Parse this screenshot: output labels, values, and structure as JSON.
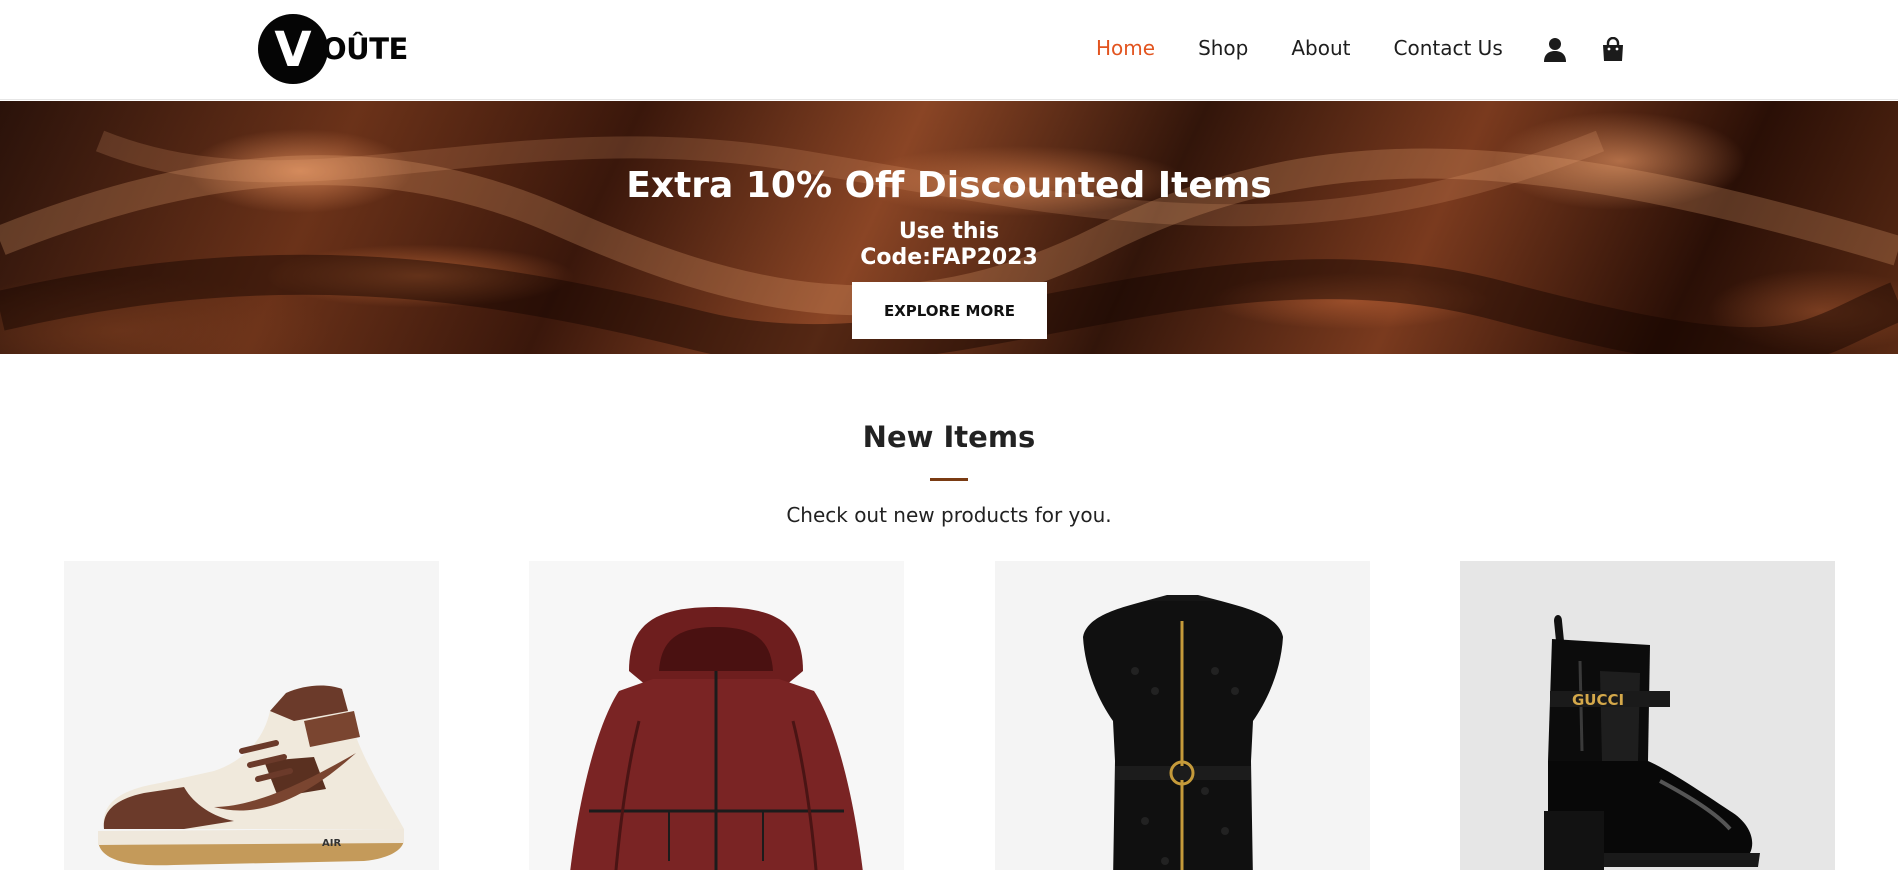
{
  "brand": {
    "logo_letter": "V",
    "logo_rest": "OÛTE"
  },
  "nav": {
    "items": [
      {
        "label": "Home",
        "active": true
      },
      {
        "label": "Shop",
        "active": false
      },
      {
        "label": "About",
        "active": false
      },
      {
        "label": "Contact Us",
        "active": false
      }
    ],
    "icons": [
      "user-icon",
      "shopping-bag-icon"
    ],
    "active_color": "#e2541f"
  },
  "hero": {
    "title": "Extra 10% Off Discounted Items",
    "subtitle_line1": "Use this",
    "subtitle_line2": "Code:FAP2023",
    "button_label": "EXPLORE MORE"
  },
  "new_items": {
    "title": "New Items",
    "subtitle": "Check out new products for you.",
    "accent_color": "#7a3b13",
    "products": [
      {
        "image": "sneaker",
        "sneaker_text": "AIR"
      },
      {
        "image": "red-hooded-jacket"
      },
      {
        "image": "black-zip-dress"
      },
      {
        "image": "black-ankle-boot",
        "brand_text": "GUCCI"
      }
    ]
  }
}
